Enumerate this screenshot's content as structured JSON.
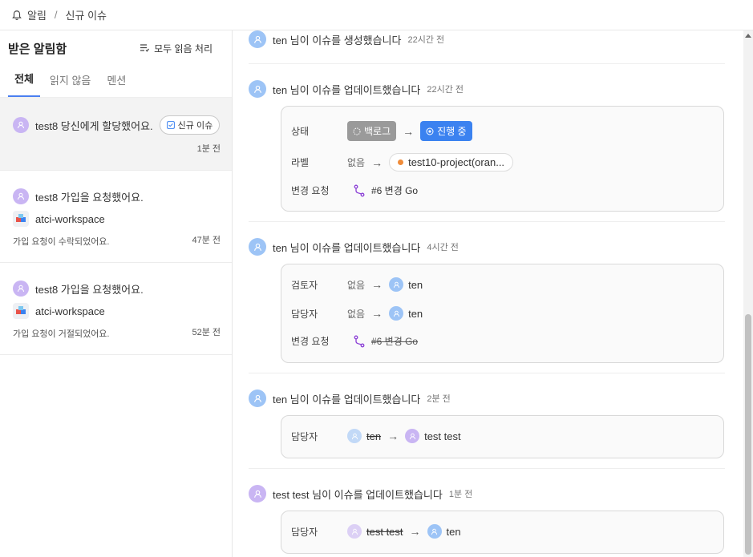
{
  "breadcrumb": {
    "home": "알림",
    "current": "신규 이슈"
  },
  "inbox": {
    "title": "받은 알림함",
    "mark_all": "모두 읽음 처리",
    "tabs": [
      "전체",
      "읽지 않음",
      "멘션"
    ],
    "notifications": [
      {
        "text": "test8 당신에게 할당했어요.",
        "chip": "신규 이슈",
        "time": "1분 전"
      },
      {
        "text": "test8 가입을 요청했어요.",
        "workspace": "atci-workspace",
        "status": "가입 요청이 수락되었어요.",
        "time": "47분 전"
      },
      {
        "text": "test8 가입을 요청했어요.",
        "workspace": "atci-workspace",
        "status": "가입 요청이 거절되었어요.",
        "time": "52분 전"
      }
    ]
  },
  "activity": [
    {
      "text": "ten 님이 이슈를 생성했습니다",
      "time": "22시간 전"
    },
    {
      "text": "ten 님이 이슈를 업데이트했습니다",
      "time": "22시간 전",
      "status_key": "상태",
      "status_old": "백로그",
      "status_new": "진행 중",
      "label_key": "라벨",
      "label_none": "없음",
      "label_value": "test10-project(oran...",
      "pr_key": "변경 요청",
      "pr_value": "#6 변경 Go"
    },
    {
      "text": "ten 님이 이슈를 업데이트했습니다",
      "time": "4시간 전",
      "reviewer_key": "검토자",
      "reviewer_none": "없음",
      "reviewer_value": "ten",
      "assignee_key": "담당자",
      "assignee_none": "없음",
      "assignee_value": "ten",
      "pr_key": "변경 요청",
      "pr_value": "#6 변경 Go"
    },
    {
      "text": "ten 님이 이슈를 업데이트했습니다",
      "time": "2분 전",
      "assignee_key": "담당자",
      "assignee_old": "ten",
      "assignee_new": "test test"
    },
    {
      "text": "test test 님이 이슈를 업데이트했습니다",
      "time": "1분 전",
      "assignee_key": "담당자",
      "assignee_old": "test test",
      "assignee_new": "ten"
    }
  ],
  "colors": {
    "accent": "#3b82f0",
    "backlog": "#9a9a9a",
    "label_dot": "#f08c3a",
    "avatar_purple": "#c9b5f3",
    "avatar_blue": "#9dc4f6",
    "pr_icon": "#8b3fd6"
  }
}
